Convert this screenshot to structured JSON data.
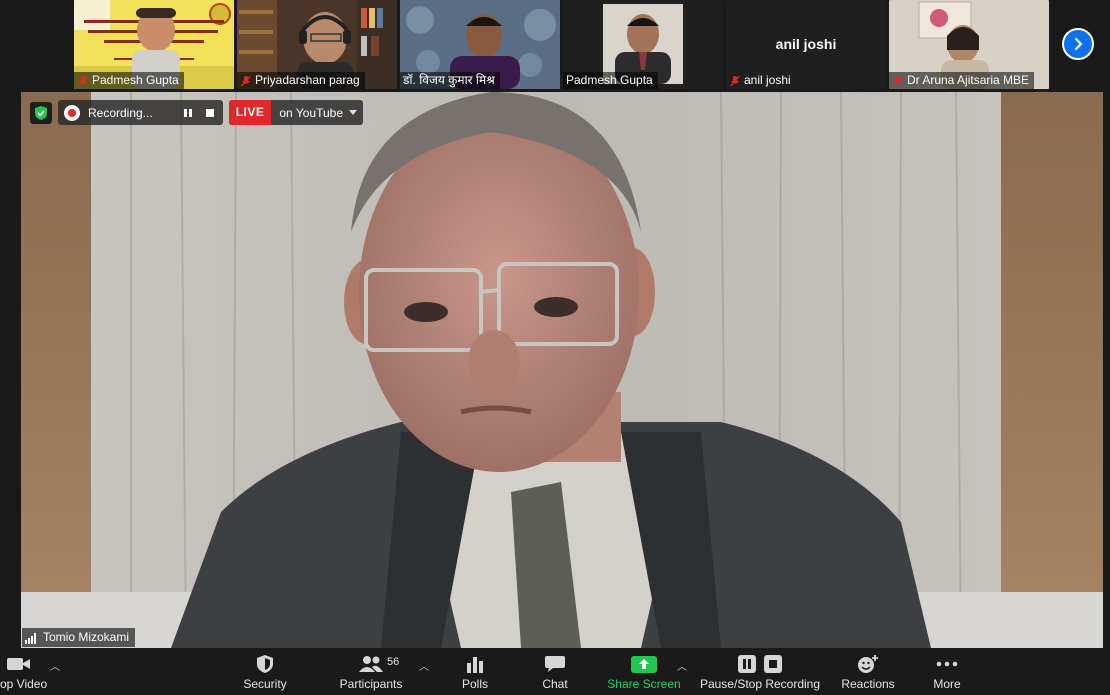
{
  "gallery": {
    "tiles": [
      {
        "name": "Padmesh Gupta",
        "muted": true
      },
      {
        "name": "Priyadarshan parag",
        "muted": true
      },
      {
        "name": "डॉ. विजय कुमार मिश्र",
        "muted": false
      },
      {
        "name": "Padmesh Gupta",
        "muted": false
      },
      {
        "name": "anil joshi",
        "muted": true,
        "center_label": "anil joshi"
      },
      {
        "name": "Dr Aruna Ajitsaria MBE",
        "muted": true
      }
    ]
  },
  "recording": {
    "label": "Recording...",
    "live_badge": "LIVE",
    "live_target": "on YouTube"
  },
  "main_speaker": {
    "name": "Tomio Mizokami"
  },
  "toolbar": {
    "video": "op Video",
    "security": "Security",
    "participants": "Participants",
    "participants_count": "56",
    "polls": "Polls",
    "chat": "Chat",
    "share_screen": "Share Screen",
    "pause_stop_recording": "Pause/Stop Recording",
    "reactions": "Reactions",
    "more": "More"
  },
  "colors": {
    "accent_blue": "#0e72ed",
    "share_green": "#23c551",
    "live_red": "#e02828",
    "mute_red": "#e02828"
  }
}
